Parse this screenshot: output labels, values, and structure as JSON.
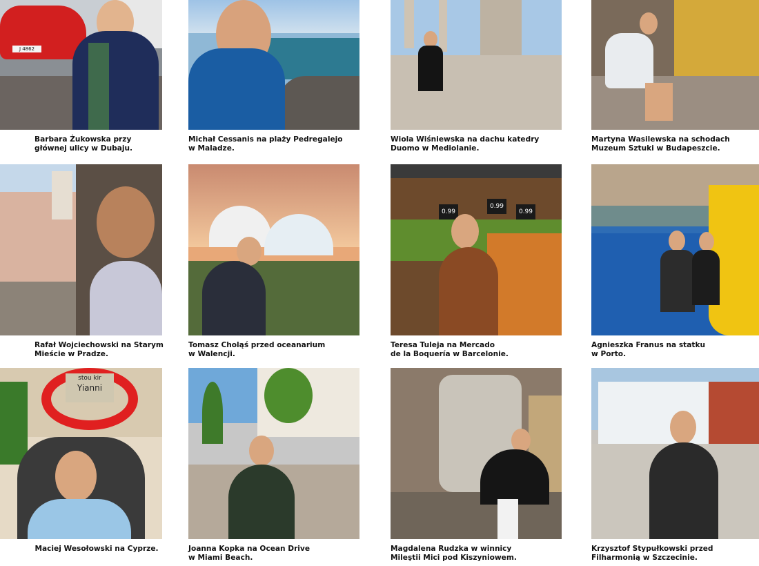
{
  "photos": [
    {
      "caption": "Barbara Żukowska przy\ngłównej ulicy w Dubaju."
    },
    {
      "caption": "Michał Cessanis na plaży Pedregalejo\nw Maladze."
    },
    {
      "caption": "Wiola Wiśniewska na dachu katedry\nDuomo w Mediolanie."
    },
    {
      "caption": "Martyna Wasilewska na schodach\nMuzeum Sztuki w Budapeszcie."
    },
    {
      "caption": "Rafał Wojciechowski na Starym\nMieście w Pradze."
    },
    {
      "caption": "Tomasz Choląś przed oceanarium\nw Walencji."
    },
    {
      "caption": "Teresa Tuleja na Mercado\nde la Boquería w Barcelonie."
    },
    {
      "caption": "Agnieszka Franus na statku\nw Porto."
    },
    {
      "caption": "Maciej Wesołowski na Cyprze."
    },
    {
      "caption": "Joanna Kopka na Ocean Drive\nw Miami Beach."
    },
    {
      "caption": "Magdalena Rudzka w winnicy\nMileştii Mici pod Kiszyniowem."
    },
    {
      "caption": "Krzysztof Stypułkowski przed\nFilharmonią w Szczecinie."
    }
  ],
  "photo_signs": {
    "plate": "J 4862",
    "price_1": "0.99",
    "price_2": "0.99",
    "price_3": "0.99",
    "sign_top": "stou kir",
    "sign_bottom": "Yianni"
  }
}
